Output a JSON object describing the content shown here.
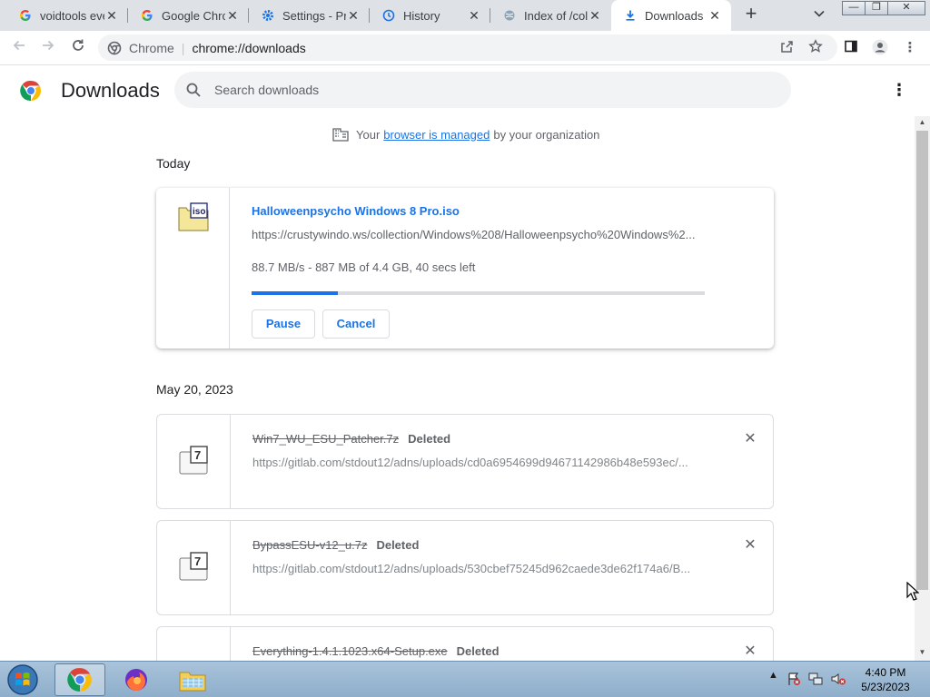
{
  "tabs": [
    {
      "title": "voidtools everything",
      "favicon": "google-g-icon"
    },
    {
      "title": "Google Chrome",
      "favicon": "google-g-icon"
    },
    {
      "title": "Settings - Privacy",
      "favicon": "settings-gear-icon"
    },
    {
      "title": "History",
      "favicon": "history-clock-icon"
    },
    {
      "title": "Index of /collection",
      "favicon": "globe-icon"
    },
    {
      "title": "Downloads",
      "favicon": "download-icon"
    }
  ],
  "omnibox": {
    "scheme_label": "Chrome",
    "url": "chrome://downloads"
  },
  "page": {
    "title": "Downloads",
    "search_placeholder": "Search downloads"
  },
  "managed": {
    "prefix": "Your",
    "link": "browser is managed",
    "suffix": "by your organization"
  },
  "groups": [
    {
      "date": "Today",
      "items": [
        {
          "filename": "Halloweenpsycho Windows 8 Pro.iso",
          "url": "https://crustywindo.ws/collection/Windows%208/Halloweenpsycho%20Windows%2...",
          "status_text": "88.7 MB/s - 887 MB of 4.4 GB, 40 secs left",
          "progress_fraction": 0.19,
          "pause_label": "Pause",
          "cancel_label": "Cancel"
        }
      ]
    },
    {
      "date": "May 20, 2023",
      "items": [
        {
          "filename": "Win7_WU_ESU_Patcher.7z",
          "state": "Deleted",
          "url": "https://gitlab.com/stdout12/adns/uploads/cd0a6954699d94671142986b48e593ec/..."
        },
        {
          "filename": "BypassESU-v12_u.7z",
          "state": "Deleted",
          "url": "https://gitlab.com/stdout12/adns/uploads/530cbef75245d962caede3de62f174a6/B..."
        },
        {
          "filename": "Everything-1.4.1.1023.x64-Setup.exe",
          "state": "Deleted",
          "url": ""
        }
      ]
    }
  ],
  "taskbar": {
    "time": "4:40 PM",
    "date": "5/23/2023"
  },
  "colors": {
    "accent": "#1a73e8",
    "tabstrip": "#dee1e6",
    "taskbar": "#9db8d2"
  }
}
